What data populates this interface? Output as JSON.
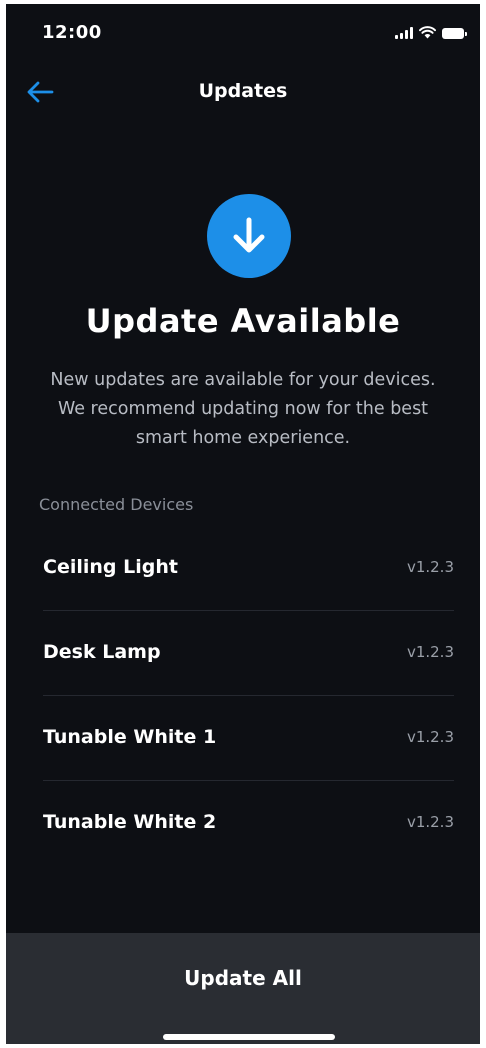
{
  "status_bar": {
    "time": "12:00",
    "signal_icon": "cellular-signal-icon",
    "wifi_icon": "wifi-icon",
    "battery_icon": "battery-icon"
  },
  "header": {
    "title": "Updates",
    "back_icon": "arrow-left-icon"
  },
  "hero": {
    "icon": "download-arrow-icon",
    "title": "Update Available",
    "description": "New updates are available for your devices. We recommend updating now for the best smart home experience."
  },
  "devices": {
    "section_label": "Connected Devices",
    "items": [
      {
        "name": "Ceiling Light",
        "version": "v1.2.3"
      },
      {
        "name": "Desk Lamp",
        "version": "v1.2.3"
      },
      {
        "name": "Tunable White 1",
        "version": "v1.2.3"
      },
      {
        "name": "Tunable White 2",
        "version": "v1.2.3"
      }
    ]
  },
  "footer": {
    "update_all_label": "Update All"
  },
  "colors": {
    "background": "#0d0f14",
    "accent": "#1d8fe8",
    "footer_background": "#2a2d33",
    "secondary_text": "#b8bcc4",
    "muted_text": "#8a8f98"
  }
}
